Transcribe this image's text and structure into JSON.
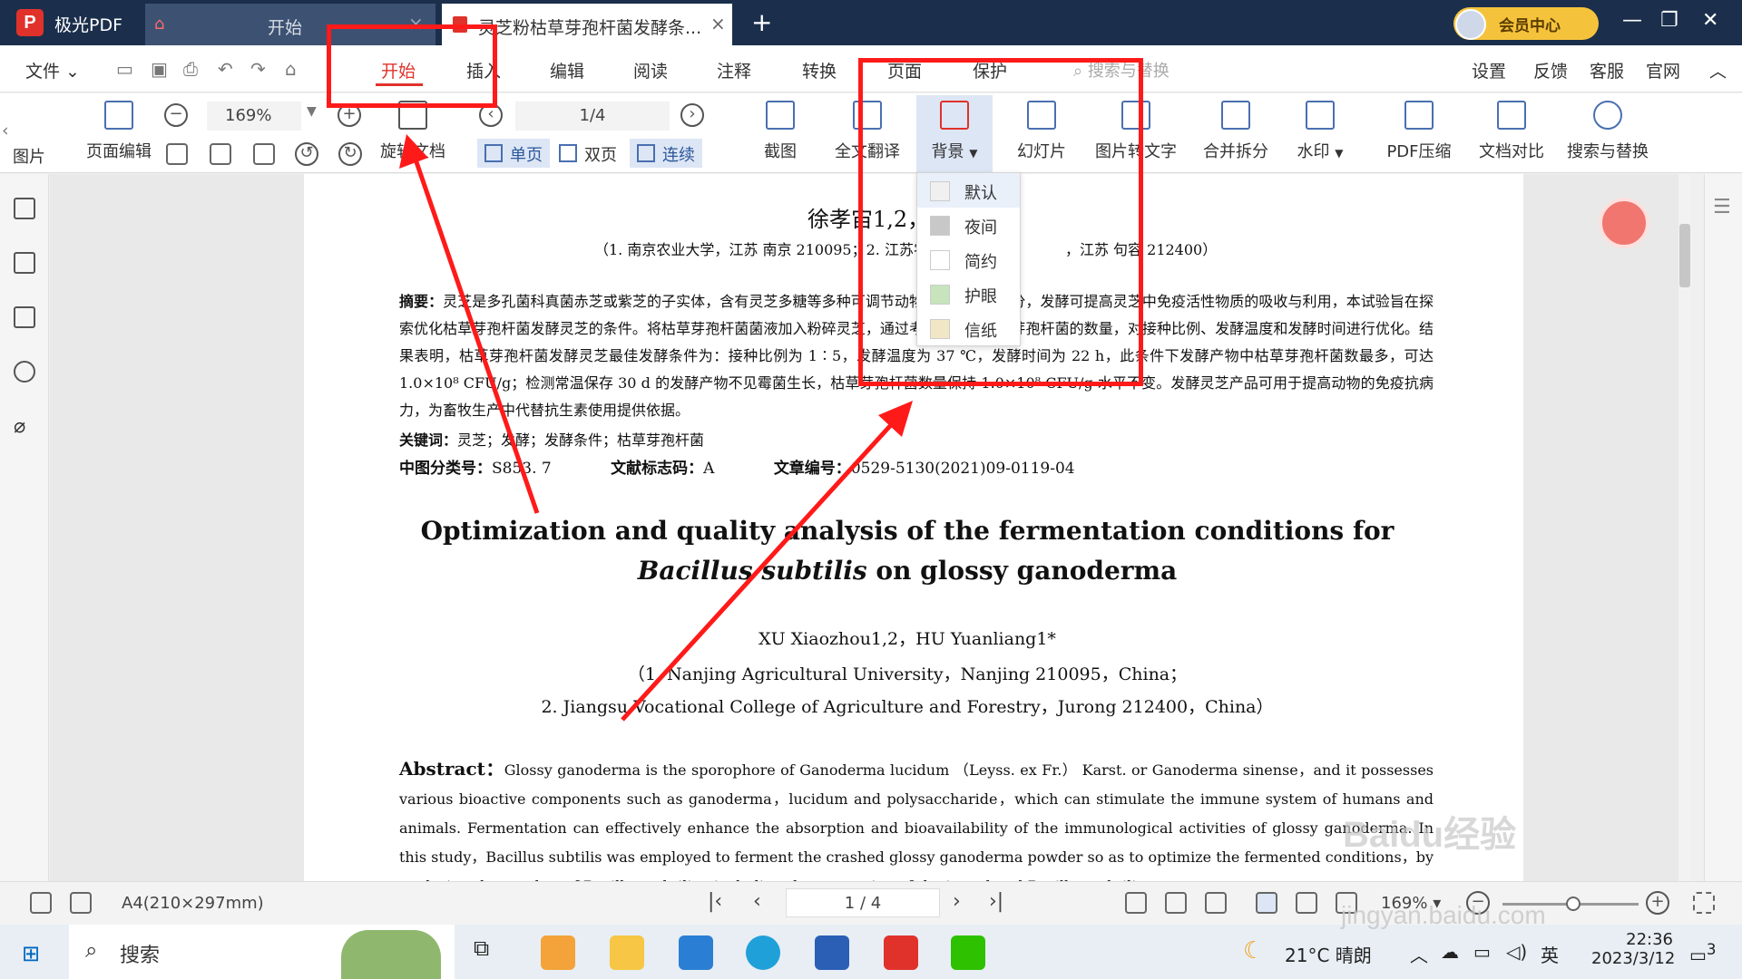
{
  "app": {
    "name": "极光PDF",
    "logo_letter": "P"
  },
  "tabs": [
    {
      "label": "开始",
      "active": false
    },
    {
      "label": "灵芝粉枯草芽孢杆菌发酵条...",
      "active": true
    }
  ],
  "vip_label": "会员中心",
  "menu": {
    "file": "文件",
    "items": [
      "开始",
      "插入",
      "编辑",
      "阅读",
      "注释",
      "转换",
      "页面",
      "保护"
    ],
    "active": "开始",
    "search_placeholder": "搜索与替换",
    "right_items": [
      "设置",
      "反馈",
      "客服",
      "官网"
    ]
  },
  "toolbar": {
    "cut_label": "图片",
    "page_edit": "页面编辑",
    "zoom": "169%",
    "page": "1/4",
    "rotate": "旋转文档",
    "view_modes": [
      "单页",
      "双页",
      "连续"
    ],
    "tools": [
      "截图",
      "全文翻译",
      "背景",
      "幻灯片",
      "图片转文字",
      "合并拆分",
      "水印",
      "PDF压缩",
      "文档对比",
      "搜索与替换"
    ]
  },
  "background_menu": {
    "items": [
      {
        "label": "默认",
        "color": "#f0f0f0"
      },
      {
        "label": "夜间",
        "color": "#c8c8c8"
      },
      {
        "label": "简约",
        "color": "#ffffff"
      },
      {
        "label": "护眼",
        "color": "#c7e4bd"
      },
      {
        "label": "信纸",
        "color": "#f1e6c6"
      }
    ]
  },
  "document": {
    "authors_cn": "徐孝宙1,2，胡元",
    "affil_cn": "（1. 南京农业大学，江苏 南京   210095；2. 江苏农林",
    "affil_cn_tail": "，江苏 句容   212400）",
    "abstract_cn_label": "摘要：",
    "abstract_cn": "灵芝是多孔菌科真菌赤芝或紫芝的子实体，含有灵芝多糖等多种可调节动物免疫的活性成分，发酵可提高灵芝中免疫活性物质的吸收与利用，本试验旨在探索优化枯草芽孢杆菌发酵灵芝的条件。将枯草芽孢杆菌菌液加入粉碎灵芝，通过考查发酵后枯草芽孢杆菌的数量，对接种比例、发酵温度和发酵时间进行优化。结果表明，枯草芽孢杆菌发酵灵芝最佳发酵条件为：接种比例为 1∶5，发酵温度为 37 ℃，发酵时间为 22 h，此条件下发酵产物中枯草芽孢杆菌数最多，可达 1.0×10⁸ CFU/g；检测常温保存 30 d 的发酵产物不见霉菌生长，枯草芽孢杆菌数量保持 1.0×10⁸ CFU/g 水平不变。发酵灵芝产品可用于提高动物的免疫抗病力，为畜牧生产中代替抗生素使用提供依据。",
    "keywords_label": "关键词：",
    "keywords": "灵芝；发酵；发酵条件；枯草芽孢杆菌",
    "class_label": "中图分类号：",
    "class_value": "S853. 7",
    "doc_label": "文献标志码：",
    "doc_value": "A",
    "article_label": "文章编号：",
    "article_value": "0529-5130(2021)09-0119-04",
    "title_en_1": "Optimization and quality analysis of the fermentation conditions for",
    "title_en_2_italic": "Bacillus subtilis",
    "title_en_2_rest": " on glossy ganoderma",
    "authors_en": "XU Xiaozhou1,2，HU Yuanliang1*",
    "affil_en_1": "（1.  Nanjing Agricultural University，Nanjing 210095，China；",
    "affil_en_2": "2.  Jiangsu Vocational College of Agriculture and Forestry，Jurong 212400，China）",
    "abstract_en_label": "Abstract：",
    "abstract_en": "Glossy ganoderma is the sporophore of Ganoderma lucidum （Leyss. ex Fr.） Karst. or Ganoderma sinense，and it possesses various bioactive components such as ganoderma，lucidum and polysaccharide，which can stimulate the immune system of humans and animals. Fermentation can effectively enhance the absorption and bioavailability of the immunological activities of glossy ganoderma. In this study，Bacillus subtilis was employed to ferment the crashed glossy ganoderma powder so as to optimize the fermented conditions，by analyzing the number of Bacillus subtilis，including the proportion of the inoculated Bacillus subtilis"
  },
  "status": {
    "paper_size": "A4(210×297mm)",
    "page": "1 / 4",
    "zoom": "169%"
  },
  "taskbar": {
    "search": "搜索",
    "weather": "21°C  晴朗",
    "ime": "英",
    "time": "22:36",
    "date": "2023/3/12",
    "notif": "3"
  },
  "watermark": {
    "brand": "Baidu经验",
    "url": "jingyan.baidu.com"
  },
  "colors": {
    "titlebar": "#1b2f4c",
    "accent": "#e0322b",
    "annotation": "#ff1a1a",
    "vip": "#f5c33b"
  }
}
